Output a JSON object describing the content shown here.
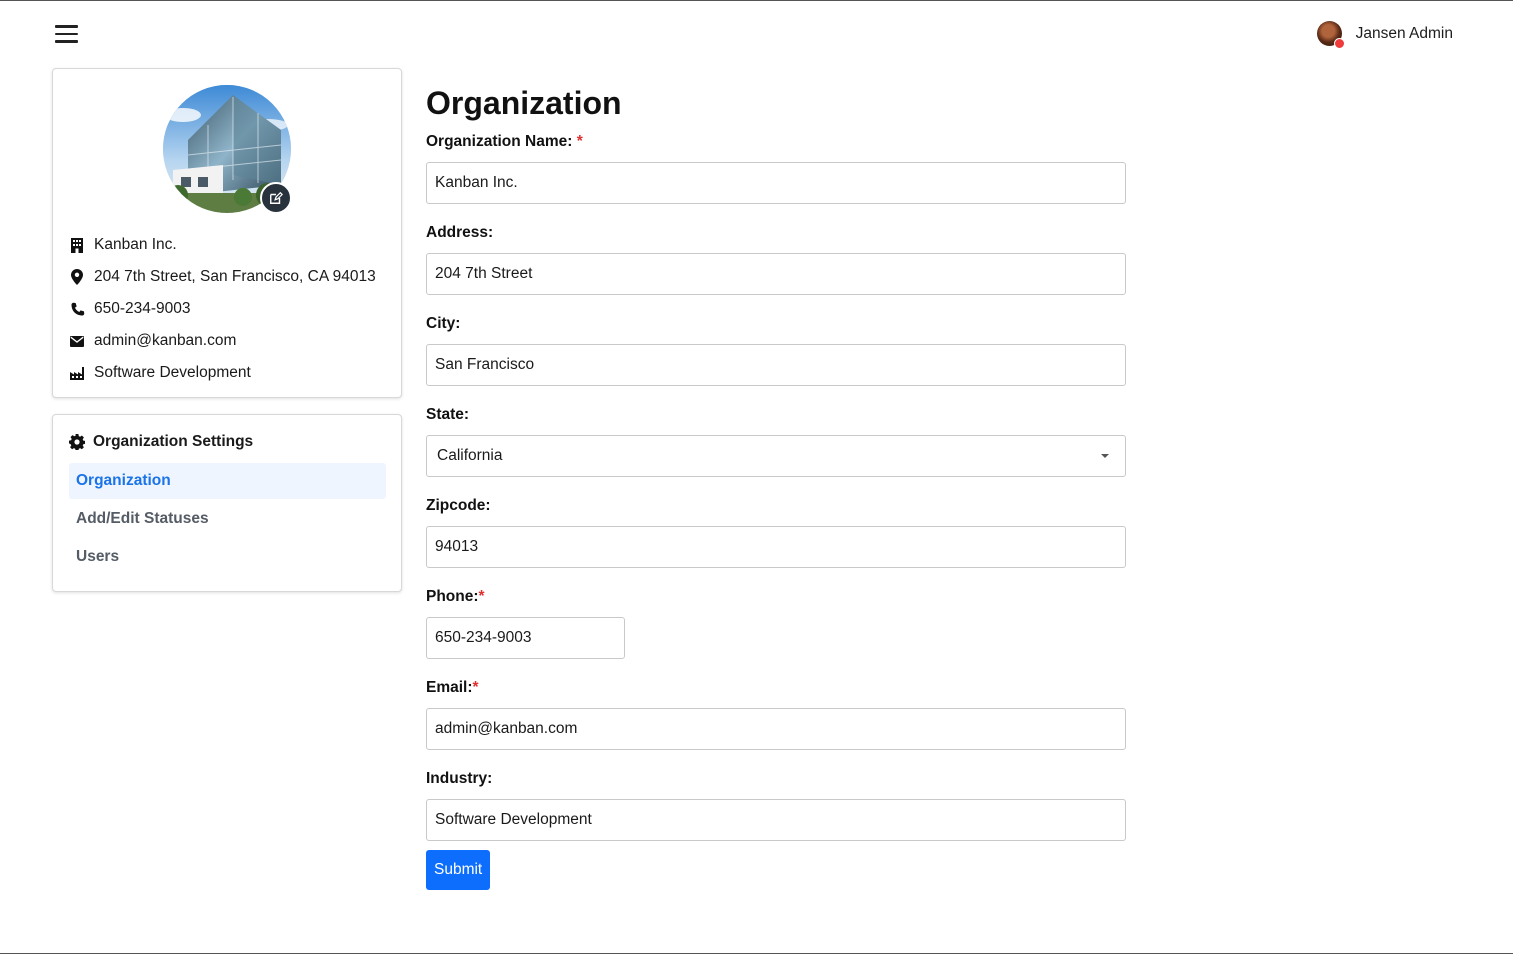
{
  "header": {
    "user_name": "Jansen Admin"
  },
  "profile": {
    "name": "Kanban Inc.",
    "address": "204 7th Street, San Francisco, CA 94013",
    "phone": "650-234-9003",
    "email": "admin@kanban.com",
    "industry": "Software Development"
  },
  "settings": {
    "heading": "Organization Settings",
    "items": [
      {
        "label": "Organization"
      },
      {
        "label": "Add/Edit Statuses"
      },
      {
        "label": "Users"
      }
    ]
  },
  "form": {
    "title": "Organization",
    "required_mark": "*",
    "org_name_label": "Organization Name:",
    "org_name_value": "Kanban Inc.",
    "address_label": "Address:",
    "address_value": "204 7th Street",
    "city_label": "City:",
    "city_value": "San Francisco",
    "state_label": "State:",
    "state_value": "California",
    "zipcode_label": "Zipcode:",
    "zipcode_value": "94013",
    "phone_label": "Phone:",
    "phone_value": "650-234-9003",
    "email_label": "Email:",
    "email_value": "admin@kanban.com",
    "industry_label": "Industry:",
    "industry_value": "Software Development",
    "submit_label": "Submit"
  },
  "colors": {
    "primary": "#0d6efd",
    "active_nav_text": "#1a73e8",
    "active_nav_bg": "#eef5ff",
    "required": "#e03131",
    "notification_dot": "#ef3b3b"
  },
  "icons": {
    "menu": "hamburger-menu-icon",
    "edit": "edit-icon",
    "building": "building-icon",
    "location": "location-pin-icon",
    "phone": "phone-icon",
    "email": "envelope-icon",
    "industry": "factory-icon",
    "settings": "gear-icon"
  }
}
